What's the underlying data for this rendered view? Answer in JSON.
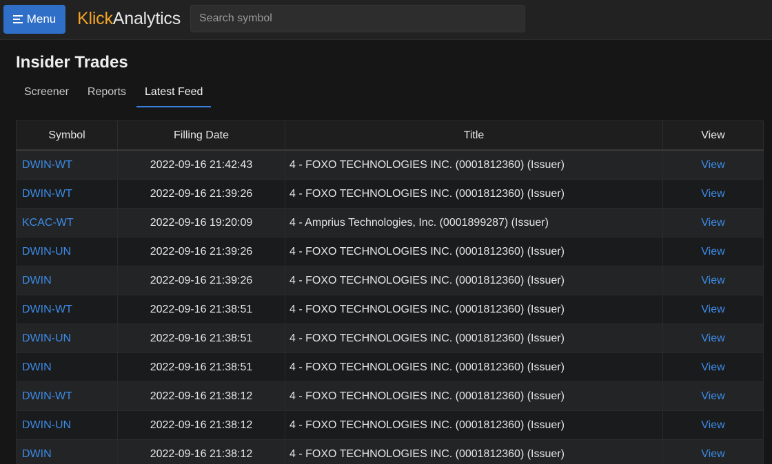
{
  "topbar": {
    "menu_label": "Menu",
    "brand_part1": "Klick",
    "brand_part2": "Analytics",
    "search_placeholder": "Search symbol"
  },
  "page": {
    "title": "Insider Trades"
  },
  "tabs": [
    {
      "label": "Screener",
      "active": false
    },
    {
      "label": "Reports",
      "active": false
    },
    {
      "label": "Latest Feed",
      "active": true
    }
  ],
  "table": {
    "headers": [
      "Symbol",
      "Filling Date",
      "Title",
      "View"
    ],
    "rows": [
      {
        "symbol": "DWIN-WT",
        "date": "2022-09-16 21:42:43",
        "title": "4 - FOXO TECHNOLOGIES INC. (0001812360) (Issuer)",
        "view": "View"
      },
      {
        "symbol": "DWIN-WT",
        "date": "2022-09-16 21:39:26",
        "title": "4 - FOXO TECHNOLOGIES INC. (0001812360) (Issuer)",
        "view": "View"
      },
      {
        "symbol": "KCAC-WT",
        "date": "2022-09-16 19:20:09",
        "title": "4 - Amprius Technologies, Inc. (0001899287) (Issuer)",
        "view": "View"
      },
      {
        "symbol": "DWIN-UN",
        "date": "2022-09-16 21:39:26",
        "title": "4 - FOXO TECHNOLOGIES INC. (0001812360) (Issuer)",
        "view": "View"
      },
      {
        "symbol": "DWIN",
        "date": "2022-09-16 21:39:26",
        "title": "4 - FOXO TECHNOLOGIES INC. (0001812360) (Issuer)",
        "view": "View"
      },
      {
        "symbol": "DWIN-WT",
        "date": "2022-09-16 21:38:51",
        "title": "4 - FOXO TECHNOLOGIES INC. (0001812360) (Issuer)",
        "view": "View"
      },
      {
        "symbol": "DWIN-UN",
        "date": "2022-09-16 21:38:51",
        "title": "4 - FOXO TECHNOLOGIES INC. (0001812360) (Issuer)",
        "view": "View"
      },
      {
        "symbol": "DWIN",
        "date": "2022-09-16 21:38:51",
        "title": "4 - FOXO TECHNOLOGIES INC. (0001812360) (Issuer)",
        "view": "View"
      },
      {
        "symbol": "DWIN-WT",
        "date": "2022-09-16 21:38:12",
        "title": "4 - FOXO TECHNOLOGIES INC. (0001812360) (Issuer)",
        "view": "View"
      },
      {
        "symbol": "DWIN-UN",
        "date": "2022-09-16 21:38:12",
        "title": "4 - FOXO TECHNOLOGIES INC. (0001812360) (Issuer)",
        "view": "View"
      },
      {
        "symbol": "DWIN",
        "date": "2022-09-16 21:38:12",
        "title": "4 - FOXO TECHNOLOGIES INC. (0001812360) (Issuer)",
        "view": "View"
      }
    ]
  },
  "colors": {
    "accent": "#2f6fc7",
    "brand_orange": "#f3a525",
    "link": "#3d8ce8",
    "tab_underline": "#3b82e0"
  },
  "icons": {
    "menu": "hamburger-menu-icon"
  }
}
